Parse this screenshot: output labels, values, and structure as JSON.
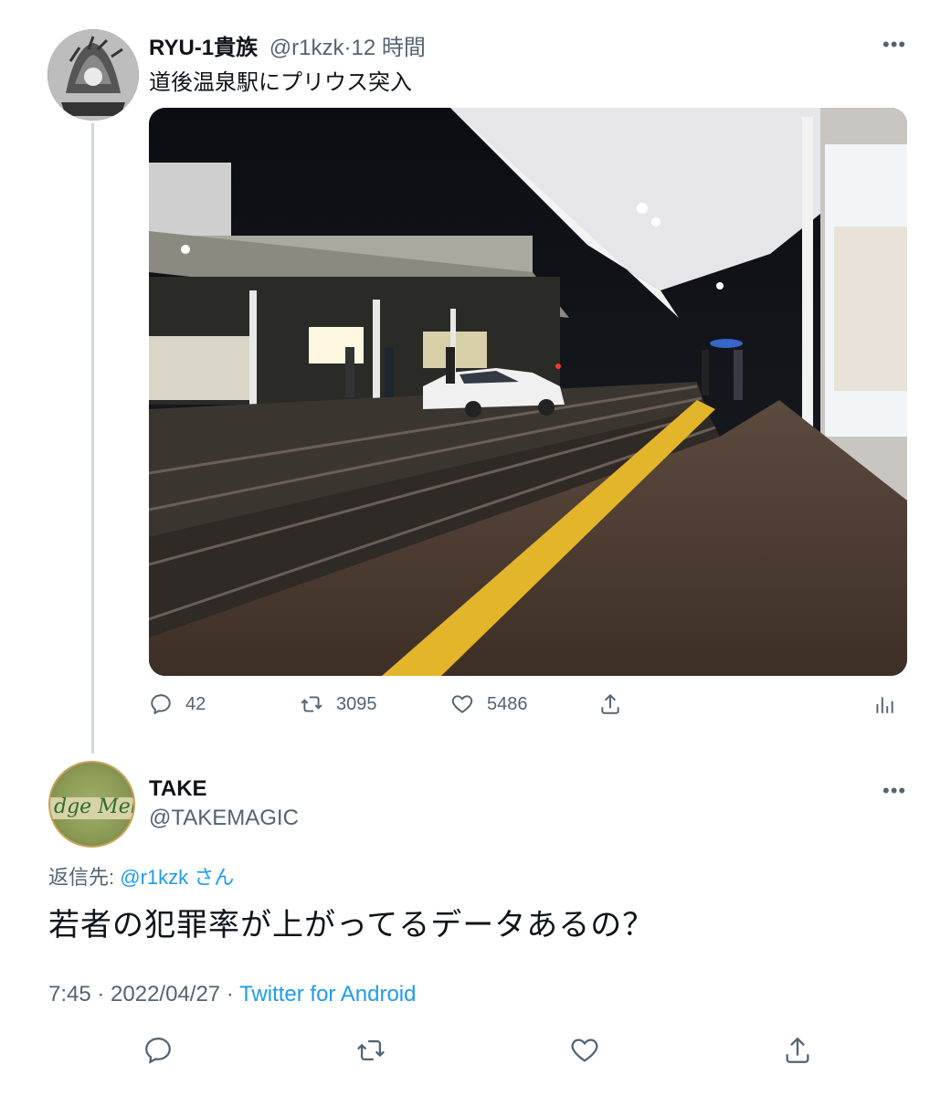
{
  "tweet": {
    "author_name": "RYU-1貴族",
    "author_handle": "@r1kzk",
    "separator": "·",
    "time": "12 時間",
    "text": "道後温泉駅にプリウス突入",
    "more": "•••",
    "stats": {
      "replies": "42",
      "retweets": "3095",
      "likes": "5486"
    }
  },
  "reply": {
    "author_name": "TAKE",
    "author_handle": "@TAKEMAGIC",
    "more": "•••",
    "replying_to_label": "返信先:",
    "replying_to_handle": "@r1kzk",
    "replying_to_suffix": "さん",
    "text": "若者の犯罪率が上がってるデータあるの？",
    "timestamp": "7:45 · 2022/04/27 · ",
    "source": "Twitter for Android",
    "avatar_text": "dge Mell"
  },
  "icons": {
    "reply": "reply-icon",
    "retweet": "retweet-icon",
    "like": "heart-icon",
    "share": "share-icon",
    "analytics": "analytics-icon"
  },
  "colors": {
    "accent": "#1d9bf0",
    "secondary_text": "#536471",
    "thread_line": "#cfd9de"
  }
}
